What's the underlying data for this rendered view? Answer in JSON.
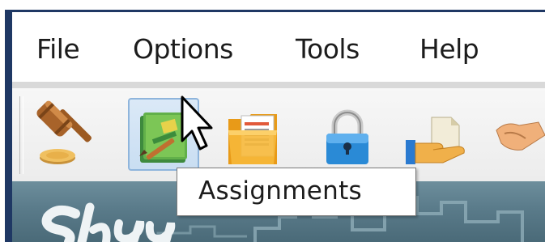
{
  "menu": {
    "items": [
      {
        "label": "File"
      },
      {
        "label": "Options"
      },
      {
        "label": "Tools"
      },
      {
        "label": "Help"
      }
    ]
  },
  "toolbar": {
    "buttons": [
      {
        "icon": "gavel-icon"
      },
      {
        "icon": "assignments-icon"
      },
      {
        "icon": "folder-documents-icon"
      },
      {
        "icon": "lock-icon"
      },
      {
        "icon": "hand-document-icon"
      },
      {
        "icon": "handshake-icon"
      }
    ],
    "hovered_button": "assignments-icon"
  },
  "tooltip": {
    "text": "Assignments"
  },
  "colors": {
    "frame": "#1f3864",
    "hover_fill": "#c9def2",
    "hover_border": "#8fb5dc",
    "banner": "#5a7b8a"
  }
}
